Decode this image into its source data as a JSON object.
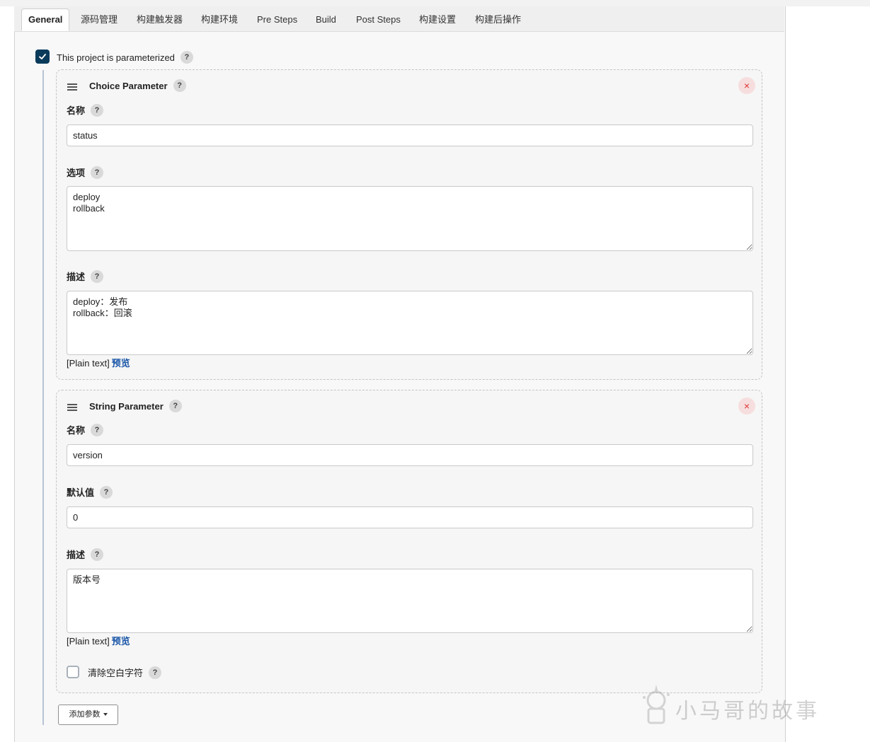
{
  "tabs": [
    "General",
    "源码管理",
    "构建触发器",
    "构建环境",
    "Pre Steps",
    "Build",
    "Post Steps",
    "构建设置",
    "构建后操作"
  ],
  "active_tab": "General",
  "parameterized": {
    "label": "This project is parameterized",
    "checked": true
  },
  "help_glyph": "?",
  "close_glyph": "×",
  "choice_param": {
    "title": "Choice Parameter",
    "name_label": "名称",
    "name_value": "status",
    "options_label": "选项",
    "options_value": "deploy\nrollback",
    "desc_label": "描述",
    "desc_value": "deploy：发布\nrollback：回滚",
    "plain_text": "[Plain text]",
    "preview": "预览"
  },
  "string_param": {
    "title": "String Parameter",
    "name_label": "名称",
    "name_value": "version",
    "default_label": "默认值",
    "default_value": "0",
    "desc_label": "描述",
    "desc_value": "版本号",
    "plain_text": "[Plain text]",
    "preview": "预览",
    "trim_label": "清除空白字符",
    "trim_checked": false
  },
  "add_param_button": "添加参数",
  "watermark": "小马哥的故事",
  "colors": {
    "accent": "#0b3b5b",
    "link": "#1a56a8",
    "close": "#d33333"
  }
}
